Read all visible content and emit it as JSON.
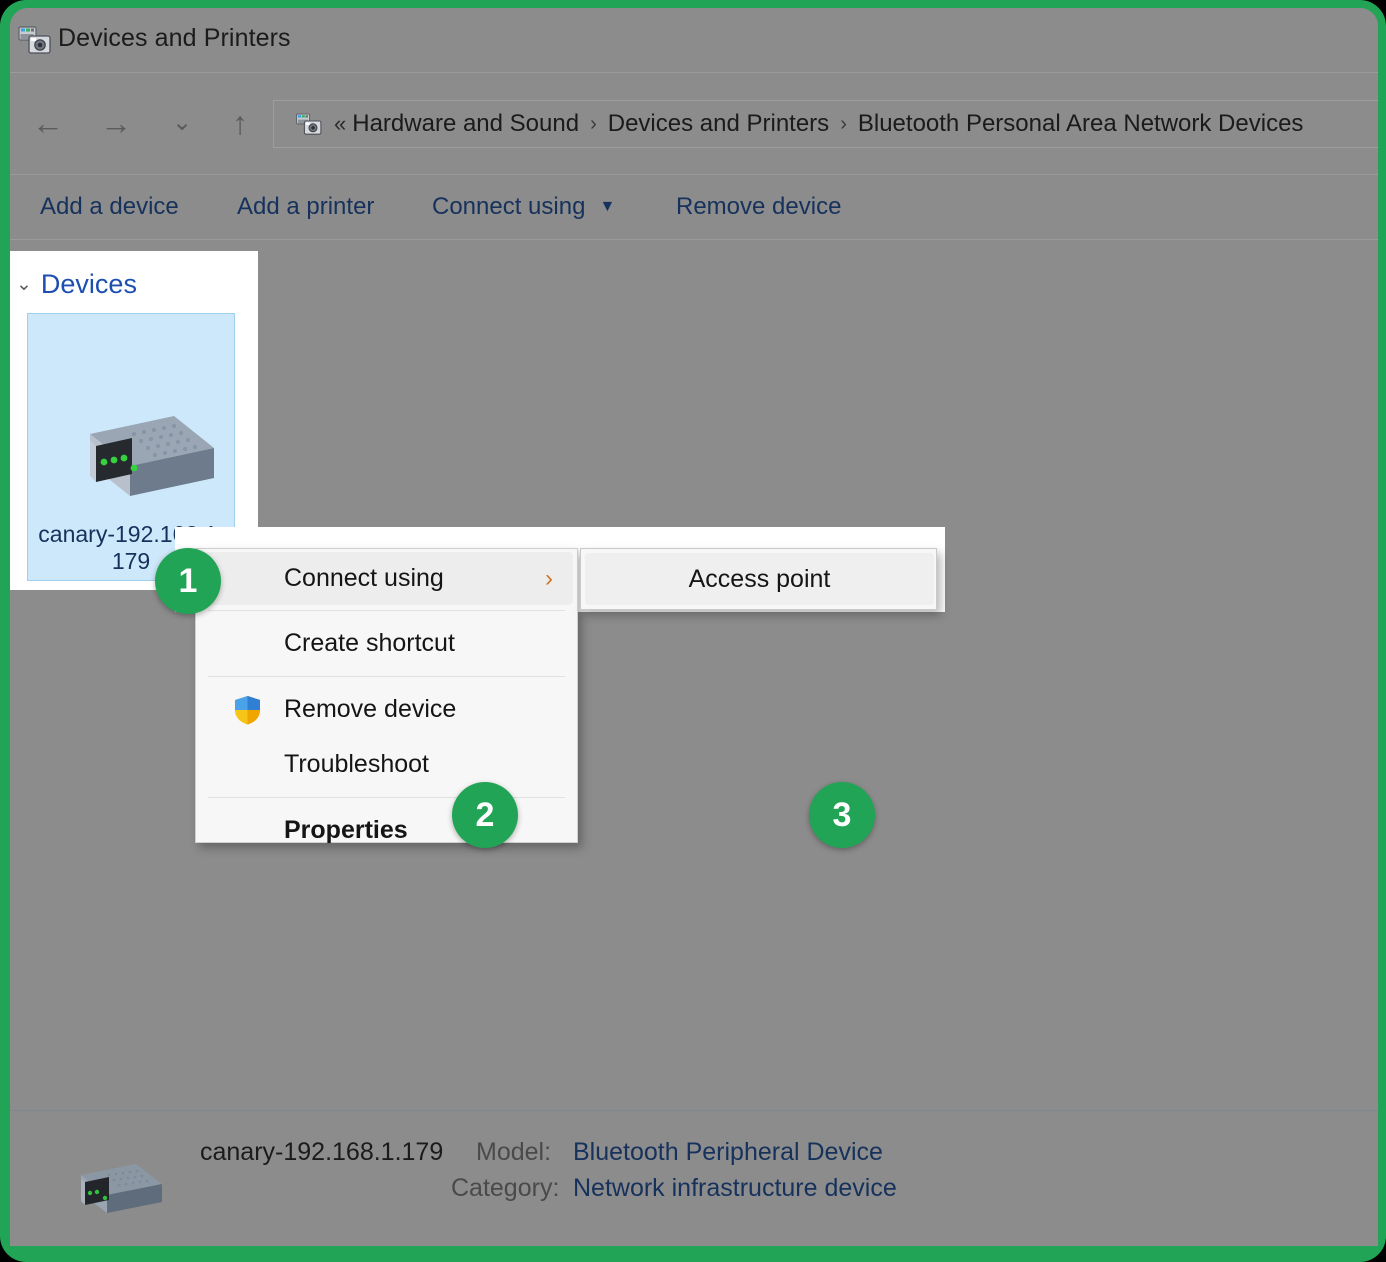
{
  "window": {
    "title": "Devices and Printers",
    "icon": "devices-and-printers-icon"
  },
  "navigation": {
    "back": "←",
    "forward": "→",
    "recent": "⌄",
    "up": "↑",
    "double_chevron": "«",
    "breadcrumb": [
      "Hardware and Sound",
      "Devices and Printers",
      "Bluetooth Personal Area Network Devices"
    ],
    "separator": "›"
  },
  "toolbar": {
    "add_device": "Add a device",
    "add_printer": "Add a printer",
    "connect_using": "Connect using",
    "connect_using_caret": "▼",
    "remove_device": "Remove device"
  },
  "devices_panel": {
    "group_label": "Devices",
    "group_chevron": "⌄",
    "device": {
      "name": "canary-192.168.1.\n179",
      "icon": "network-device-icon"
    }
  },
  "context_menu": {
    "items": [
      {
        "label": "Connect using",
        "highlighted": true,
        "has_submenu": true,
        "submenu_arrow": "›"
      },
      {
        "label": "Create shortcut",
        "highlighted": false,
        "has_submenu": false
      },
      {
        "label": "Remove device",
        "highlighted": false,
        "icon": "uac-shield-icon"
      },
      {
        "label": "Troubleshoot",
        "highlighted": false
      },
      {
        "label": "Properties",
        "highlighted": false,
        "bold": true
      }
    ]
  },
  "submenu": {
    "items": [
      {
        "label": "Access point",
        "highlighted": true
      }
    ]
  },
  "badges": {
    "step1": "1",
    "step2": "2",
    "step3": "3"
  },
  "status_bar": {
    "device_name": "canary-192.168.1.179",
    "model_label": "Model:",
    "model_value": "Bluetooth Peripheral Device",
    "category_label": "Category:",
    "category_value": "Network infrastructure device"
  },
  "colors": {
    "accent_green": "#21a455",
    "window_chrome": "#8c8c8c",
    "link_blue": "#16325c",
    "selection_blue": "#cde8fa",
    "group_header_blue": "#1c4fb0"
  }
}
